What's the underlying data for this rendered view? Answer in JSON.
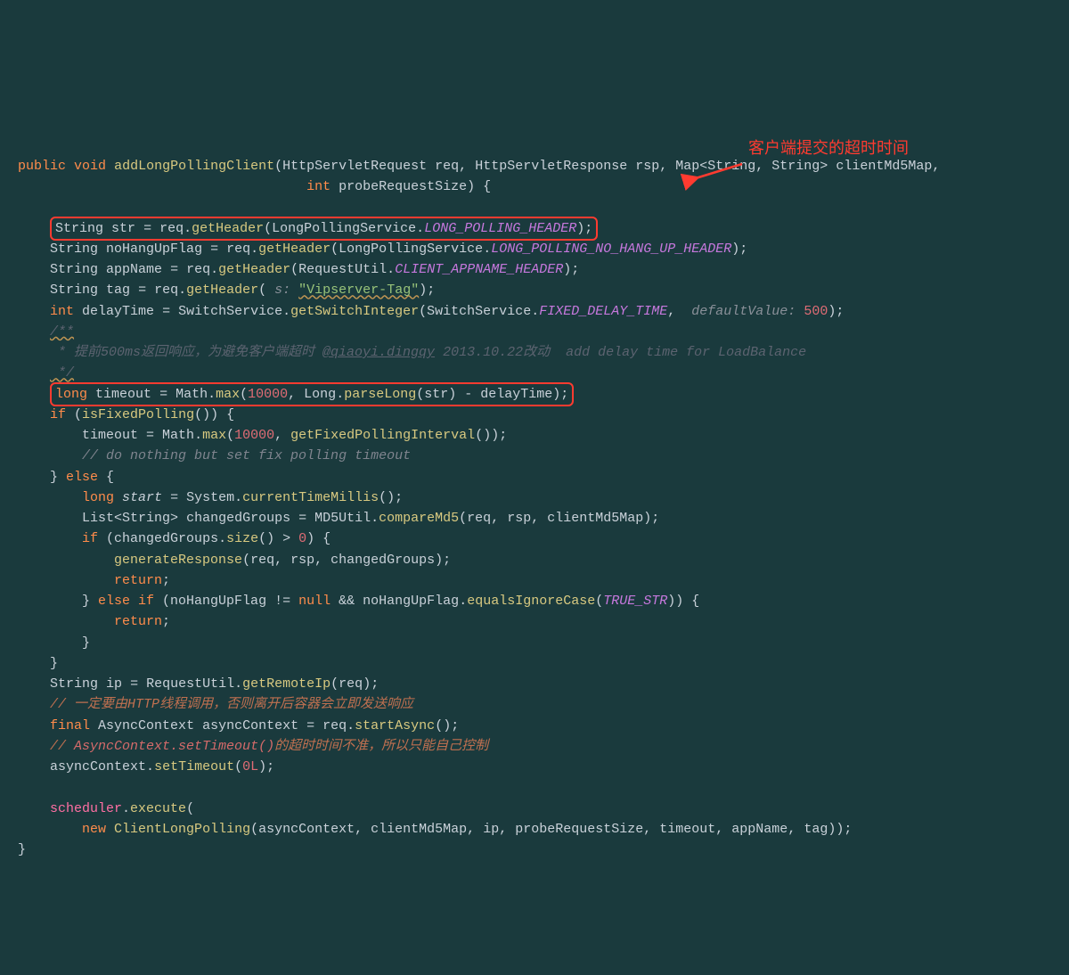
{
  "sig": {
    "kw_public": "public",
    "kw_void": "void",
    "name": "addLongPollingClient",
    "p1t": "HttpServletRequest",
    "p1n": "req",
    "p2t": "HttpServletResponse",
    "p2n": "rsp",
    "p3t": "Map<String, String>",
    "p3n": "clientMd5Map",
    "p4t": "int",
    "p4n": "probeRequestSize"
  },
  "annot": {
    "label": "客户端提交的超时时间"
  },
  "l1": {
    "t": "String",
    "v": "str",
    "eq": "=",
    "obj": "req",
    "m": "getHeader",
    "cls": "LongPollingService",
    "c": "LONG_POLLING_HEADER"
  },
  "l2": {
    "t": "String",
    "v": "noHangUpFlag",
    "obj": "req",
    "m": "getHeader",
    "cls": "LongPollingService",
    "c": "LONG_POLLING_NO_HANG_UP_HEADER"
  },
  "l3": {
    "t": "String",
    "v": "appName",
    "obj": "req",
    "m": "getHeader",
    "cls": "RequestUtil",
    "c": "CLIENT_APPNAME_HEADER"
  },
  "l4": {
    "t": "String",
    "v": "tag",
    "obj": "req",
    "m": "getHeader",
    "hint": "s:",
    "s": "\"Vipserver-Tag\""
  },
  "l5": {
    "t": "int",
    "v": "delayTime",
    "cls": "SwitchService",
    "m": "getSwitchInteger",
    "arg1cls": "SwitchService",
    "arg1c": "FIXED_DELAY_TIME",
    "hint": "defaultValue:",
    "n": "500"
  },
  "c1a": "/**",
  "c1b": " * 提前500ms返回响应，为避免客户端超时 ",
  "c1auth": "@qiaoyi.dingqy",
  "c1c": " 2013.10.22改动  add delay time for LoadBalance",
  "c1d": " */",
  "l6": {
    "t": "long",
    "v": "timeout",
    "cls": "Math",
    "m": "max",
    "n": "10000",
    "cls2": "Long",
    "m2": "parseLong",
    "a": "str",
    "b": "delayTime"
  },
  "l7": {
    "kw": "if",
    "m": "isFixedPolling"
  },
  "l8": {
    "v": "timeout",
    "cls": "Math",
    "m": "max",
    "n": "10000",
    "m2": "getFixedPollingInterval"
  },
  "c2": "// do nothing but set fix polling timeout",
  "l9": {
    "kw": "else"
  },
  "l10": {
    "t": "long",
    "v": "start",
    "cls": "System",
    "m": "currentTimeMillis"
  },
  "l11": {
    "t": "List<String>",
    "v": "changedGroups",
    "cls": "MD5Util",
    "m": "compareMd5",
    "a": "req",
    "b": "rsp",
    "c": "clientMd5Map"
  },
  "l12": {
    "kw": "if",
    "v": "changedGroups",
    "m": "size",
    "n": "0"
  },
  "l13": {
    "m": "generateResponse",
    "a": "req",
    "b": "rsp",
    "c": "changedGroups"
  },
  "l14": {
    "kw": "return"
  },
  "l15": {
    "kw": "else if",
    "v": "noHangUpFlag",
    "op": "!=",
    "n": "null",
    "m": "equalsIgnoreCase",
    "c": "TRUE_STR"
  },
  "l16": {
    "kw": "return"
  },
  "l19": {
    "t": "String",
    "v": "ip",
    "cls": "RequestUtil",
    "m": "getRemoteIp",
    "a": "req"
  },
  "c3": "// 一定要由HTTP线程调用，否则离开后容器会立即发送响应",
  "l20": {
    "kw": "final",
    "t": "AsyncContext",
    "v": "asyncContext",
    "obj": "req",
    "m": "startAsync"
  },
  "c4a": "// ",
  "c4b": "AsyncContext.setTimeout()",
  "c4c": "的超时时间不准，所以只能自己控制",
  "l21": {
    "v": "asyncContext",
    "m": "setTimeout",
    "n": "0L"
  },
  "l22": {
    "v": "scheduler",
    "m": "execute"
  },
  "l23": {
    "kw": "new",
    "t": "ClientLongPolling",
    "a": "asyncContext",
    "b": "clientMd5Map",
    "c": "ip",
    "d": "probeRequestSize",
    "e": "timeout",
    "f": "appName",
    "g": "tag"
  }
}
